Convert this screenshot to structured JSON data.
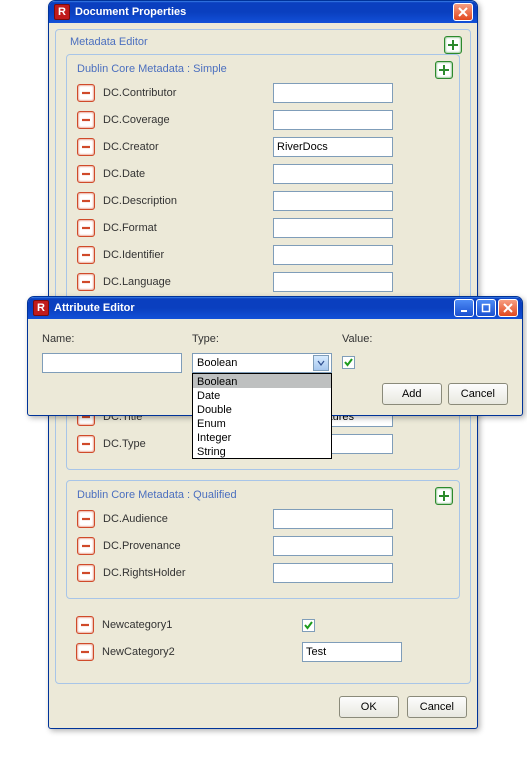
{
  "docWindow": {
    "title": "Document Properties",
    "panelTitle": "Metadata Editor",
    "simple": {
      "title": "Dublin Core Metadata : Simple",
      "fields": [
        {
          "label": "DC.Contributor",
          "value": ""
        },
        {
          "label": "DC.Coverage",
          "value": ""
        },
        {
          "label": "DC.Creator",
          "value": "RiverDocs"
        },
        {
          "label": "DC.Date",
          "value": ""
        },
        {
          "label": "DC.Description",
          "value": ""
        },
        {
          "label": "DC.Format",
          "value": ""
        },
        {
          "label": "DC.Identifier",
          "value": ""
        },
        {
          "label": "DC.Language",
          "value": ""
        }
      ],
      "tail": [
        {
          "label": "DC.Title",
          "value": "tadata Features"
        },
        {
          "label": "DC.Type",
          "value": ""
        }
      ]
    },
    "qualified": {
      "title": "Dublin Core Metadata : Qualified",
      "fields": [
        {
          "label": "DC.Audience",
          "value": ""
        },
        {
          "label": "DC.Provenance",
          "value": ""
        },
        {
          "label": "DC.RightsHolder",
          "value": ""
        }
      ]
    },
    "custom": [
      {
        "label": "Newcategory1",
        "type": "boolean",
        "checked": true
      },
      {
        "label": "NewCategory2",
        "type": "text",
        "value": "Test"
      }
    ],
    "buttons": {
      "ok": "OK",
      "cancel": "Cancel"
    }
  },
  "attrWindow": {
    "title": "Attribute Editor",
    "labels": {
      "name": "Name:",
      "type": "Type:",
      "value": "Value:"
    },
    "nameValue": "",
    "typeSelected": "Boolean",
    "typeOptions": [
      "Boolean",
      "Date",
      "Double",
      "Enum",
      "Integer",
      "String"
    ],
    "valueChecked": true,
    "buttons": {
      "add": "Add",
      "cancel": "Cancel"
    }
  }
}
